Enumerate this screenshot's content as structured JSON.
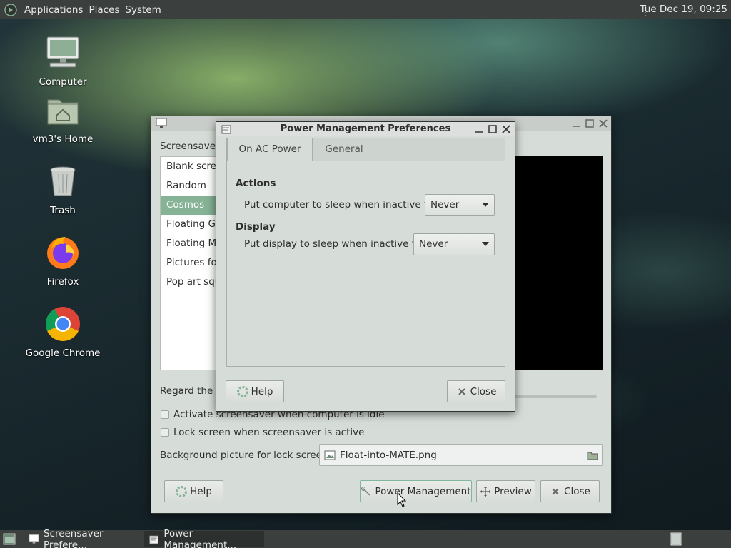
{
  "top_panel": {
    "menus": [
      "Applications",
      "Places",
      "System"
    ],
    "clock": "Tue Dec 19, 09:25"
  },
  "desktop": {
    "icons": [
      {
        "label": "Computer",
        "icon": "computer-icon"
      },
      {
        "label": "vm3's Home",
        "icon": "home-folder-icon"
      },
      {
        "label": "Trash",
        "icon": "trash-icon"
      },
      {
        "label": "Firefox",
        "icon": "firefox-icon"
      },
      {
        "label": "Google Chrome",
        "icon": "chrome-icon"
      }
    ]
  },
  "screensaver_window": {
    "theme_label": "Screensaver t",
    "themes": [
      "Blank scree",
      "Random",
      "Cosmos",
      "Floating GN",
      "Floating MA",
      "Pictures fol",
      "Pop art squ"
    ],
    "selected_theme": "Cosmos",
    "regard_label": "Regard the c",
    "activate_label": "Activate screensaver when computer is idle",
    "lock_label": "Lock screen when screensaver is active",
    "bg_label": "Background picture for lock screen:",
    "bg_file": "Float-into-MATE.png",
    "help_label": "Help",
    "power_label": "Power Management",
    "preview_label": "Preview",
    "close_label": "Close"
  },
  "power_window": {
    "title": "Power Management Preferences",
    "tabs": [
      "On AC Power",
      "General"
    ],
    "actions_heading": "Actions",
    "sleep_computer_label": "Put computer to sleep when inactive for:",
    "sleep_computer_value": "Never",
    "display_heading": "Display",
    "sleep_display_label": "Put display to sleep when inactive for:",
    "sleep_display_value": "Never",
    "help_label": "Help",
    "close_label": "Close"
  },
  "taskbar": {
    "tasks": [
      "Screensaver Prefere...",
      "Power Management..."
    ]
  }
}
